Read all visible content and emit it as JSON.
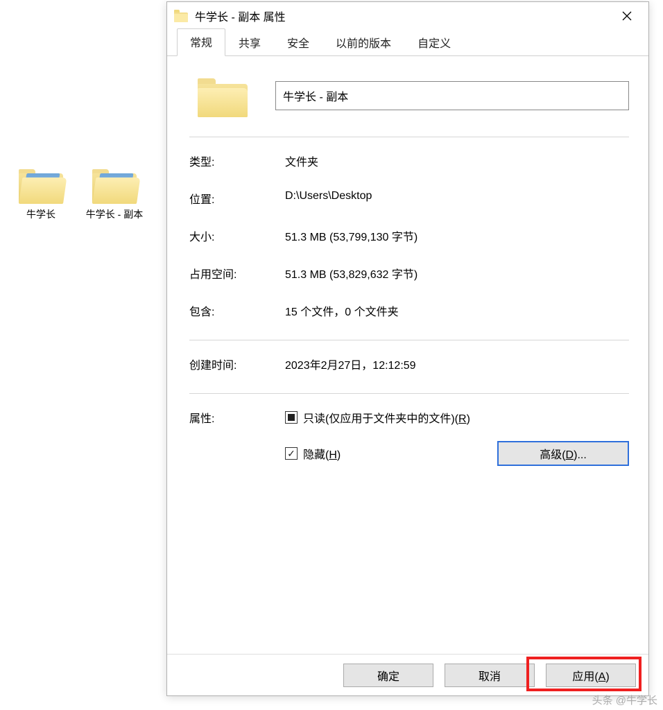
{
  "desktop": {
    "icons": [
      {
        "label": "牛学长"
      },
      {
        "label": "牛学长 - 副本"
      }
    ]
  },
  "dialog": {
    "title": "牛学长 - 副本 属性",
    "tabs": [
      "常规",
      "共享",
      "安全",
      "以前的版本",
      "自定义"
    ],
    "name_value": "牛学长 - 副本",
    "type_label": "类型:",
    "type_value": "文件夹",
    "location_label": "位置:",
    "location_value": "D:\\Users\\Desktop",
    "size_label": "大小:",
    "size_value": "51.3 MB (53,799,130 字节)",
    "disk_label": "占用空间:",
    "disk_value": "51.3 MB (53,829,632 字节)",
    "contains_label": "包含:",
    "contains_value": "15 个文件，0 个文件夹",
    "created_label": "创建时间:",
    "created_value": "2023年2月27日，12:12:59",
    "attr_label": "属性:",
    "readonly_prefix": "只读(仅应用于文件夹中的文件)(",
    "readonly_key": "R",
    "readonly_suffix": ")",
    "hidden_prefix": "隐藏(",
    "hidden_key": "H",
    "hidden_suffix": ")",
    "advanced_prefix": "高级(",
    "advanced_key": "D",
    "advanced_suffix": ")...",
    "buttons": {
      "ok": "确定",
      "cancel": "取消",
      "apply_prefix": "应用(",
      "apply_key": "A",
      "apply_suffix": ")"
    }
  },
  "watermark": "头条 @牛学长"
}
